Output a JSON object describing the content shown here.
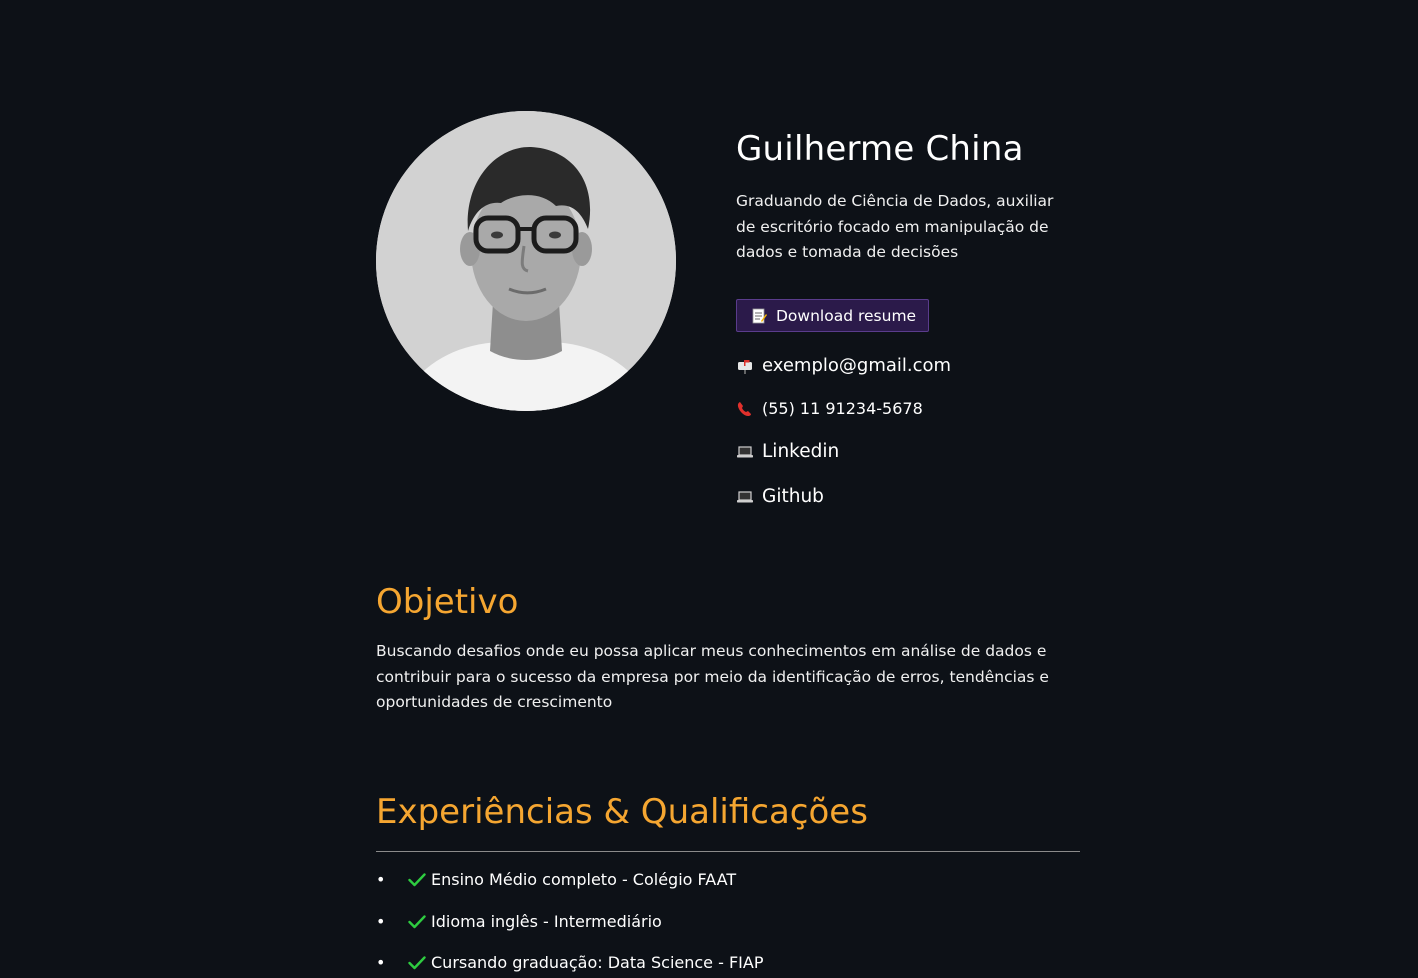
{
  "profile": {
    "name": "Guilherme China",
    "bio": "Graduando de Ciência de Dados, auxiliar de escritório focado em manipulação de dados e tomada de decisões",
    "download_label": "Download resume",
    "download_icon": "memo-icon",
    "contacts": {
      "email": "exemplo@gmail.com",
      "email_icon": "mailbox-icon",
      "phone": "(55) 11 91234-5678",
      "phone_icon": "telephone-icon",
      "linkedin": "Linkedin",
      "linkedin_icon": "laptop-icon",
      "github": "Github",
      "github_icon": "laptop-icon"
    }
  },
  "objetivo": {
    "title": "Objetivo",
    "text": "Buscando desafios onde eu possa aplicar meus conhecimentos em análise de dados e contribuir para o sucesso da empresa por meio da identificação de erros, tendências e oportunidades de crescimento"
  },
  "experiencias": {
    "title": "Experiências & Qualificações",
    "items": [
      {
        "label": "Ensino Médio completo - Colégio FAAT"
      },
      {
        "label": "Idioma inglês - Intermediário"
      },
      {
        "label": "Cursando graduação: Data Science - FIAP"
      }
    ]
  },
  "colors": {
    "background": "#0d1117",
    "accent": "#f5a631",
    "button_bg": "#2b1a4a",
    "check": "#2ecc40"
  }
}
